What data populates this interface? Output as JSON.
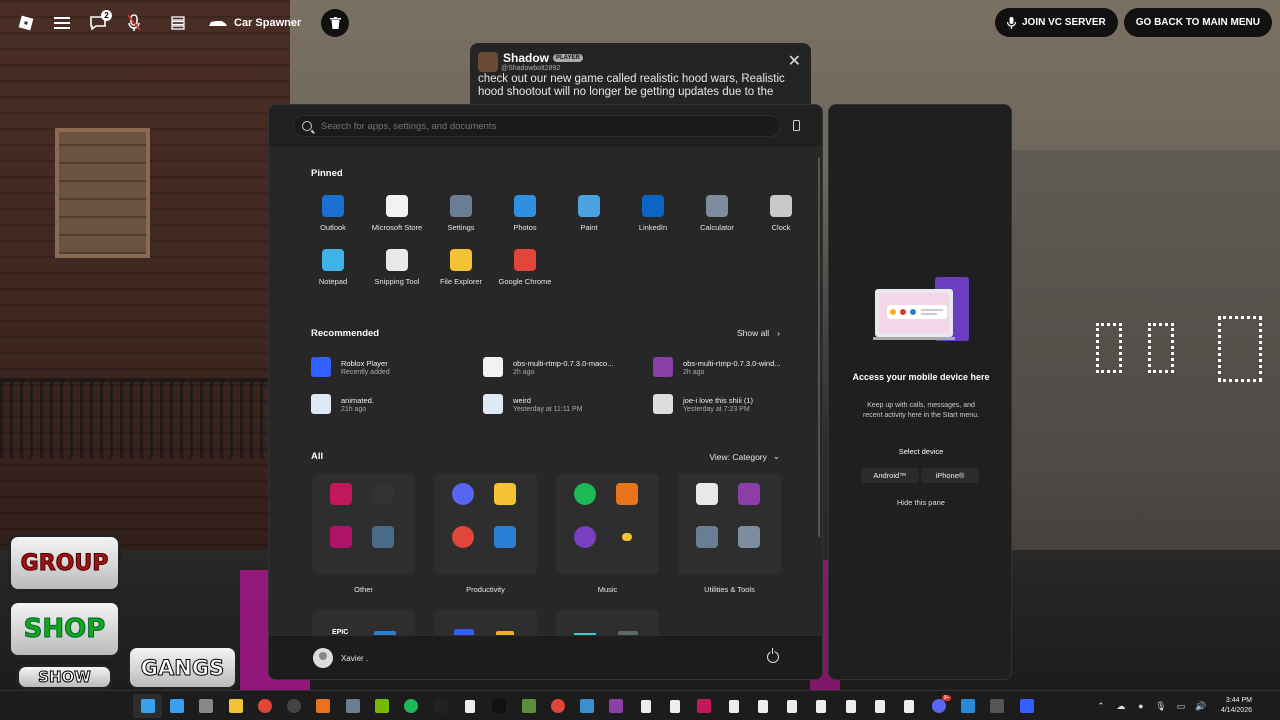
{
  "game": {
    "car_spawner_label": "Car Spawner",
    "chat_badge_count": "2",
    "join_vc_label": "JOIN VC SERVER",
    "main_menu_label": "GO BACK TO MAIN MENU",
    "buttons": {
      "group": "GROUP",
      "shop": "SHOP",
      "show": "SHOW",
      "gangs": "GANGS"
    }
  },
  "notification": {
    "name": "Shadow",
    "tag": "PLAYER",
    "handle": "@Shadowbolt2892",
    "message": "check out our new game called realistic hood wars, Realistic hood shootout will no longer be getting updates due to the"
  },
  "start_menu": {
    "search_placeholder": "Search for apps, settings, and documents",
    "pinned_title": "Pinned",
    "pinned": [
      {
        "label": "Outlook",
        "icon": "outlook-icon",
        "color": "#1a6fd0"
      },
      {
        "label": "Microsoft Store",
        "icon": "store-icon",
        "color": "#f2f2f2"
      },
      {
        "label": "Settings",
        "icon": "gear-icon",
        "color": "#6b7d93"
      },
      {
        "label": "Photos",
        "icon": "photos-icon",
        "color": "#2f8fe0"
      },
      {
        "label": "Paint",
        "icon": "paint-icon",
        "color": "#4aa3df"
      },
      {
        "label": "LinkedIn",
        "icon": "linkedin-icon",
        "color": "#0a66c2"
      },
      {
        "label": "Calculator",
        "icon": "calculator-icon",
        "color": "#7f8c9d"
      },
      {
        "label": "Clock",
        "icon": "clock-icon",
        "color": "#c9c9c9"
      },
      {
        "label": "Notepad",
        "icon": "notepad-icon",
        "color": "#3fb2e8"
      },
      {
        "label": "Snipping Tool",
        "icon": "snipping-tool-icon",
        "color": "#e8e8e8"
      },
      {
        "label": "File Explorer",
        "icon": "folder-icon",
        "color": "#f4c335"
      },
      {
        "label": "Google Chrome",
        "icon": "chrome-icon",
        "color": "#e0463a"
      }
    ],
    "recommended_title": "Recommended",
    "show_all_label": "Show all",
    "recommended": [
      {
        "name": "Roblox Player",
        "sub": "Recently added",
        "icon": "roblox-icon"
      },
      {
        "name": "obs-multi-rtmp-0.7.3.0-maco...",
        "sub": "2h ago",
        "icon": "file-icon"
      },
      {
        "name": "obs-multi-rtmp-0.7.3.0-wind...",
        "sub": "2h ago",
        "icon": "archive-icon"
      },
      {
        "name": "animated.",
        "sub": "21h ago",
        "icon": "image-file-icon"
      },
      {
        "name": "weird",
        "sub": "Yesterday at 11:11 PM",
        "icon": "image-file-icon"
      },
      {
        "name": "joe-i love this shiii (1)",
        "sub": "Yesterday at 7:23 PM",
        "icon": "video-file-icon"
      }
    ],
    "all_title": "All",
    "view_label": "View: Category",
    "categories": [
      {
        "label": "Other",
        "icons": [
          "affinity-icon",
          "obs-icon",
          "affinity-publisher-icon",
          "xbox-icon"
        ]
      },
      {
        "label": "Productivity",
        "icons": [
          "discord-icon",
          "folder-icon",
          "chrome-icon",
          "widgets-icon"
        ]
      },
      {
        "label": "Music",
        "icons": [
          "spotify-icon",
          "fl-studio-icon",
          "media-player-icon",
          "folder-small-icon"
        ]
      },
      {
        "label": "Utilities & Tools",
        "icons": [
          "snipping-tool-icon",
          "archive-icon",
          "gear-icon",
          "calculator-icon"
        ]
      }
    ],
    "partial_row_labels": [
      "EPIC"
    ],
    "user_name": "Xavier ."
  },
  "phone_pane": {
    "title": "Access your mobile device here",
    "description": "Keep up with calls, messages, and recent activity here in the Start menu.",
    "select_label": "Select device",
    "android_label": "Android™",
    "iphone_label": "iPhone®",
    "hide_label": "Hide this pane"
  },
  "taskbar": {
    "apps": [
      {
        "name": "start-icon",
        "color": "#3aa0f0"
      },
      {
        "name": "search-icon",
        "color": "#3aa0f0"
      },
      {
        "name": "task-view-icon",
        "color": "#888"
      },
      {
        "name": "file-explorer-icon",
        "color": "#f4c335"
      },
      {
        "name": "chrome-icon",
        "color": "#e0463a"
      },
      {
        "name": "obs-icon",
        "color": "#444"
      },
      {
        "name": "fl-studio-icon",
        "color": "#e8731a"
      },
      {
        "name": "settings-icon",
        "color": "#6b7d93"
      },
      {
        "name": "nvidia-icon",
        "color": "#76b900"
      },
      {
        "name": "spotify-icon",
        "color": "#1db954"
      },
      {
        "name": "epic-icon",
        "color": "#222"
      },
      {
        "name": "file-icon",
        "color": "#eee"
      },
      {
        "name": "capcut-icon",
        "color": "#111"
      },
      {
        "name": "minecraft-icon",
        "color": "#5a8f3a"
      },
      {
        "name": "chrome-icon",
        "color": "#e0463a"
      },
      {
        "name": "app-icon",
        "color": "#3a8fd0"
      },
      {
        "name": "winrar-icon",
        "color": "#8b3ea8"
      },
      {
        "name": "file-icon",
        "color": "#eee"
      },
      {
        "name": "file-icon",
        "color": "#eee"
      },
      {
        "name": "affinity-icon",
        "color": "#c2185b"
      },
      {
        "name": "file-icon",
        "color": "#eee"
      },
      {
        "name": "file-icon",
        "color": "#eee"
      },
      {
        "name": "file-icon",
        "color": "#eee"
      },
      {
        "name": "file-icon",
        "color": "#eee"
      },
      {
        "name": "file-icon",
        "color": "#eee"
      },
      {
        "name": "file-icon",
        "color": "#eee"
      },
      {
        "name": "file-icon",
        "color": "#eee"
      },
      {
        "name": "discord-icon",
        "color": "#5865f2"
      },
      {
        "name": "app-icon",
        "color": "#2a8ad4"
      },
      {
        "name": "xbox-icon",
        "color": "#555"
      },
      {
        "name": "roblox-icon",
        "color": "#335fff"
      }
    ],
    "discord_badge": "9+",
    "time": "3:44 PM",
    "date": "4/14/2026"
  }
}
